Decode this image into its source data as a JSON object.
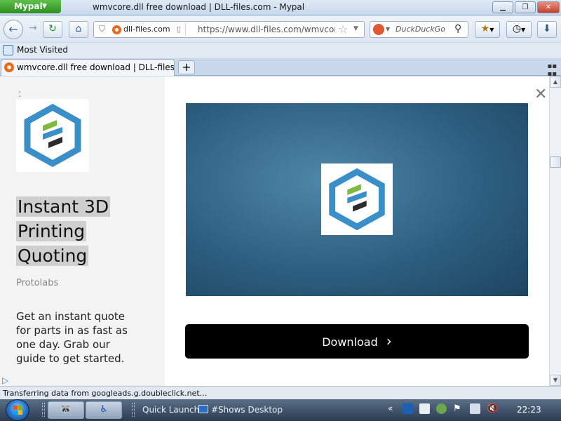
{
  "window": {
    "app_button": "Mypal",
    "title": "wmvcore.dll free download | DLL-files.com - Mypal"
  },
  "navbar": {
    "site_identity": "dll-files.com",
    "url": "https://www.dll-files.com/wmvcore.",
    "search_placeholder": "DuckDuckGo"
  },
  "bookmarks": {
    "items": [
      {
        "label": "Most Visited"
      }
    ]
  },
  "tabs": [
    {
      "label": "wmvcore.dll free download | DLL-files.c...",
      "active": true
    }
  ],
  "ad": {
    "headline_lines": [
      "Instant 3D",
      "Printing",
      "Quoting"
    ],
    "brand": "Protolabs",
    "description": "Get an instant quote for parts in as fast as one day. Grab our guide to get started.",
    "cta_label": "Download"
  },
  "status": {
    "text": "Transferring data from googleads.g.doubleclick.net..."
  },
  "taskbar": {
    "quick_launch_label": "Quick Launch",
    "shows_desktop_label": "#Shows Desktop",
    "clock": "22:23"
  },
  "colors": {
    "logo_blue": "#3a8fc9",
    "logo_green": "#7dba3f",
    "logo_dark": "#2b2b2b",
    "cta_bg": "#000000",
    "app_button_green": "#3f9f2f"
  }
}
